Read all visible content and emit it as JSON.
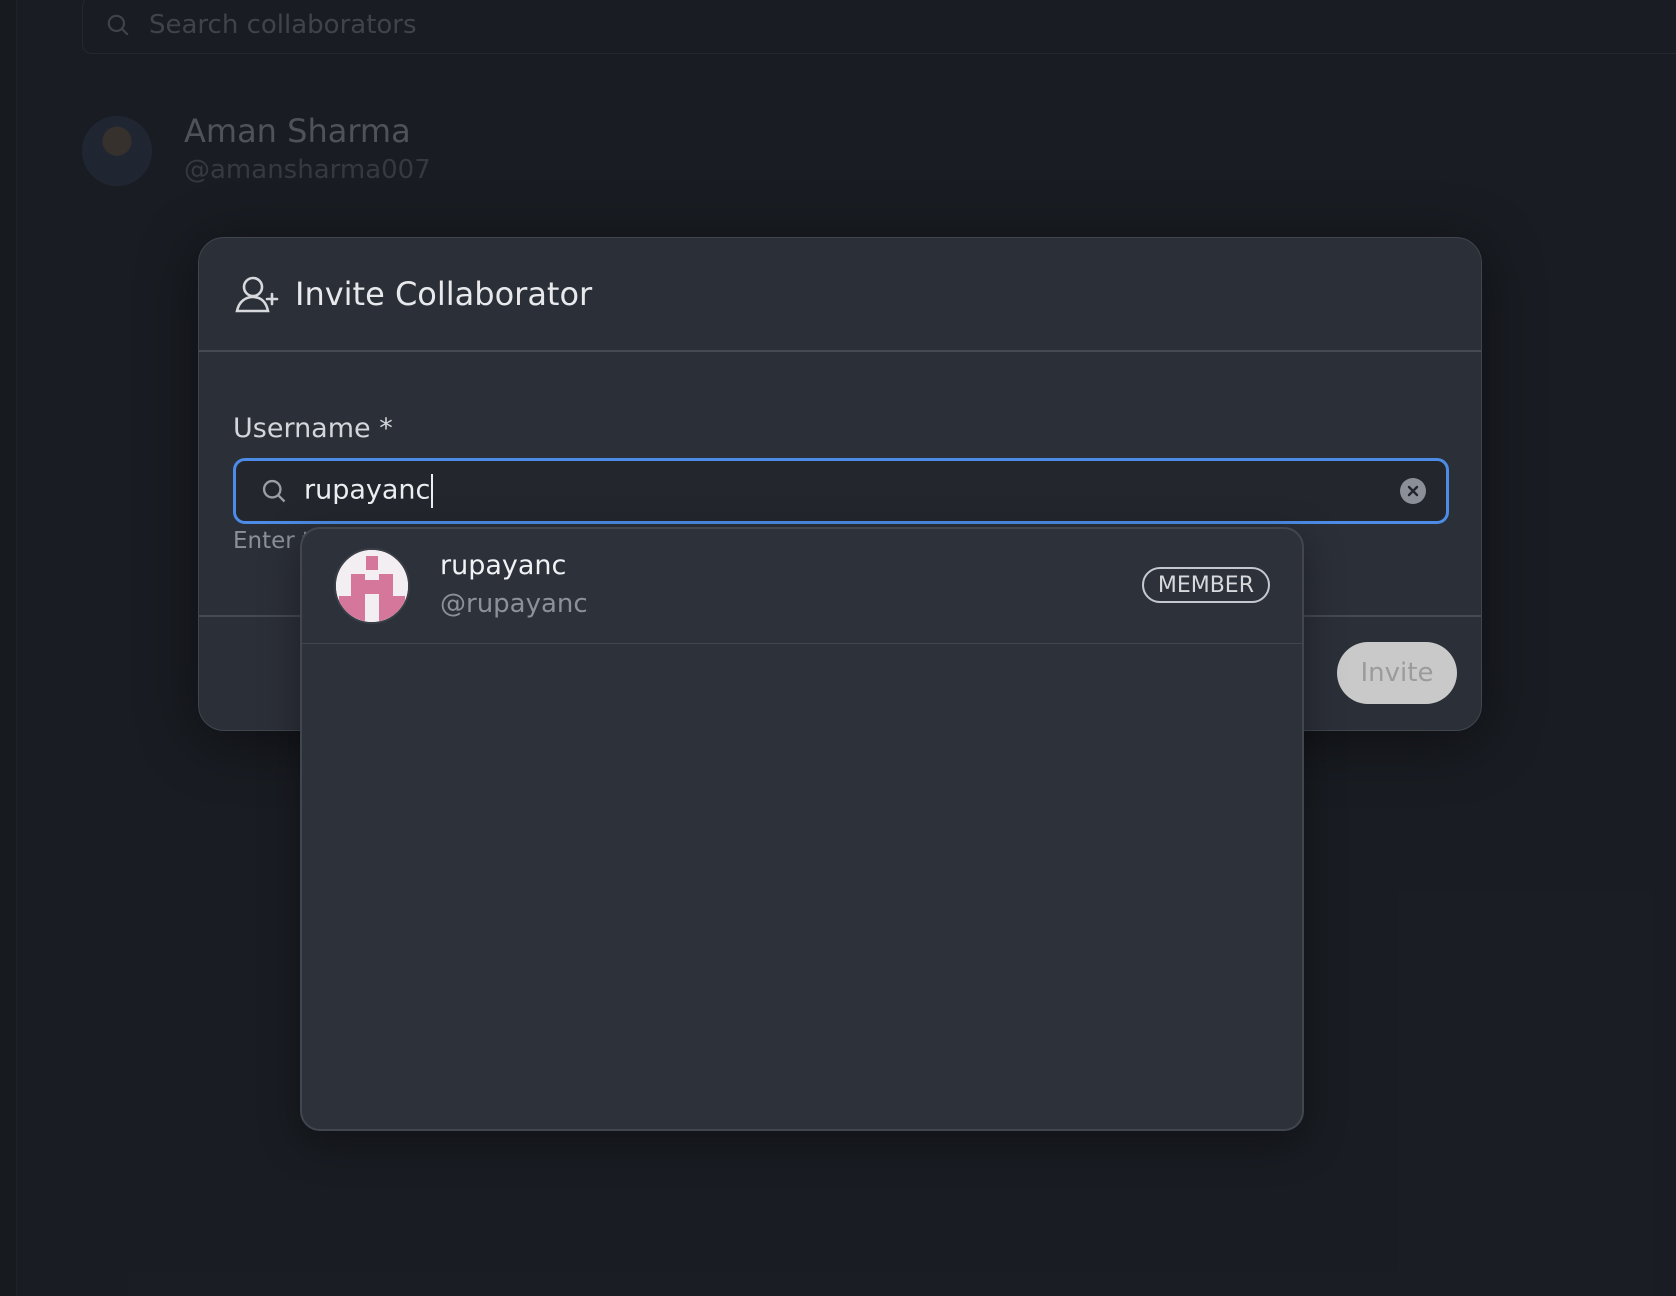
{
  "background": {
    "search": {
      "placeholder": "Search collaborators"
    },
    "user": {
      "name": "Aman Sharma",
      "handle": "@amansharma007"
    }
  },
  "modal": {
    "title": "Invite Collaborator",
    "icon": "user-plus-icon",
    "username_label": "Username *",
    "input_value": "rupayanc",
    "helper_text": "Enter t",
    "invite_label": "Invite"
  },
  "dropdown": {
    "results": [
      {
        "name": "rupayanc",
        "handle": "@rupayanc",
        "role": "MEMBER"
      }
    ]
  },
  "colors": {
    "background": "#1d2027",
    "modal": "#2b2f38",
    "focus_border": "#4c8ce6",
    "avatar_accent": "#d4779a"
  }
}
